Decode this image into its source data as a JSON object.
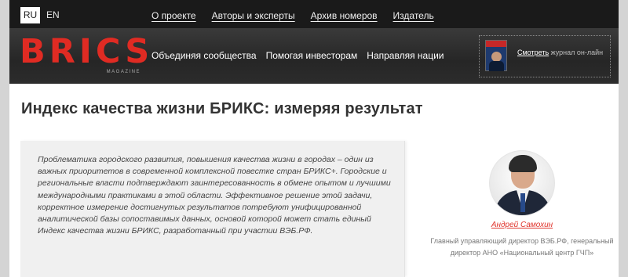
{
  "lang": {
    "ru": "RU",
    "en": "EN"
  },
  "topnav": [
    "О проекте",
    "Авторы и эксперты",
    "Архив номеров",
    "Издатель"
  ],
  "logo": {
    "word": "BRICS",
    "sub": "MAGAZINE"
  },
  "mainnav": [
    "Объединяя сообщества",
    "Помогая инвесторам",
    "Направляя нации"
  ],
  "journal": {
    "link": "Смотреть",
    "rest": " журнал он-лайн"
  },
  "article": {
    "title": "Индекс качества жизни БРИКС: измеряя результат",
    "lead": "Проблематика городского развития, повышения качества жизни в городах – один из важных приоритетов в современной комплексной повестке стран БРИКС+. Городские и региональные власти подтверждают заинтересованность в обмене опытом и лучшими международными практиками в этой области. Эффективное решение этой задачи, корректное измерение достигнутых результатов потребуют унифицированной аналитической базы сопоставимых данных, основой которой может стать единый Индекс качества жизни БРИКС, разработанный при участии ВЭБ.РФ."
  },
  "author": {
    "name": "Андрей Самохин",
    "role": "Главный управляющий директор ВЭБ.РФ, генеральный директор АНО «Национальный центр ГЧП»"
  },
  "colors": {
    "accent": "#e02b23",
    "header": "#2a2a2a",
    "topbar": "#1a1a1a"
  }
}
